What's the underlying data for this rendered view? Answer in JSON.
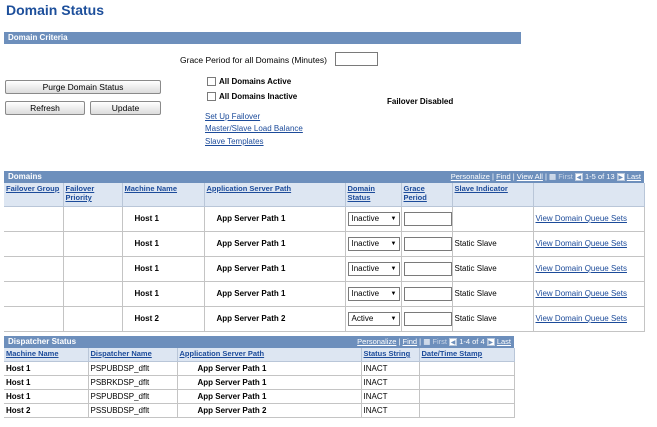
{
  "page_title": "Domain Status",
  "criteria": {
    "section_label": "Domain Criteria",
    "grace_label": "Grace Period for all Domains (Minutes)",
    "grace_value": "",
    "purge_btn": "Purge Domain Status",
    "refresh_btn": "Refresh",
    "update_btn": "Update",
    "all_active_label": "All Domains Active",
    "all_inactive_label": "All Domains Inactive",
    "failover_status": "Failover Disabled",
    "links": {
      "setup_failover": "Set Up Failover",
      "master_slave": "Master/Slave Load Balance",
      "slave_templates": "Slave Templates"
    }
  },
  "domains": {
    "title": "Domains",
    "nav": {
      "personalize": "Personalize",
      "find": "Find",
      "view_all": "View All",
      "first": "First",
      "range": "1-5 of 13",
      "last": "Last"
    },
    "headers": [
      "Failover Group",
      "Failover Priority",
      "Machine Name",
      "Application Server Path",
      "Domain Status",
      "Grace Period",
      "Slave Indicator",
      ""
    ],
    "rows": [
      {
        "machine": "Host 1",
        "path": "App Server Path 1",
        "status": "Inactive",
        "slave": "",
        "link": "View Domain Queue Sets"
      },
      {
        "machine": "Host 1",
        "path": "App Server Path 1",
        "status": "Inactive",
        "slave": "Static Slave",
        "link": "View Domain Queue Sets"
      },
      {
        "machine": "Host 1",
        "path": "App Server Path 1",
        "status": "Inactive",
        "slave": "Static Slave",
        "link": "View Domain Queue Sets"
      },
      {
        "machine": "Host 1",
        "path": "App Server Path 1",
        "status": "Inactive",
        "slave": "Static Slave",
        "link": "View Domain Queue Sets"
      },
      {
        "machine": "Host 2",
        "path": "App Server Path 2",
        "status": "Active",
        "slave": "Static Slave",
        "link": "View Domain Queue Sets"
      }
    ]
  },
  "dispatcher": {
    "title": "Dispatcher Status",
    "nav": {
      "personalize": "Personalize",
      "find": "Find",
      "first": "First",
      "range": "1-4 of 4",
      "last": "Last"
    },
    "headers": [
      "Machine Name",
      "Dispatcher Name",
      "Application Server Path",
      "Status String",
      "Date/Time Stamp"
    ],
    "rows": [
      {
        "machine": "Host 1",
        "name": "PSPUBDSP_dflt",
        "path": "App Server Path 1",
        "status": "INACT",
        "stamp": ""
      },
      {
        "machine": "Host 1",
        "name": "PSBRKDSP_dflt",
        "path": "App Server Path 1",
        "status": "INACT",
        "stamp": ""
      },
      {
        "machine": "Host 1",
        "name": "PSPUBDSP_dflt",
        "path": "App Server Path 1",
        "status": "INACT",
        "stamp": ""
      },
      {
        "machine": "Host 2",
        "name": "PSSUBDSP_dflt",
        "path": "App Server Path 2",
        "status": "INACT",
        "stamp": ""
      }
    ]
  }
}
